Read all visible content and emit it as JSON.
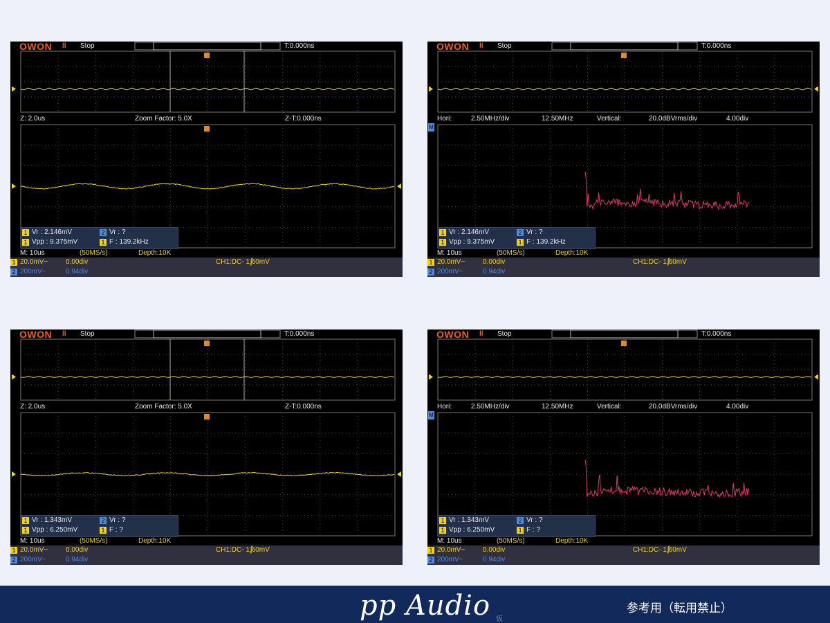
{
  "colors": {
    "trace": "#f3d21a",
    "fft": "#e0386c",
    "grid": "#444",
    "bg": "#000",
    "brand": "#f25c1e"
  },
  "scopes": [
    {
      "mode": "zoom",
      "logo": "OWON",
      "run_icon": "pause-icon",
      "state": "Stop",
      "trigger_time": "T:0.000ns",
      "mid_left": "Z: 2.0us",
      "mid_center": "Zoom Factor: 5.0X",
      "mid_right": "Z-T:0.000ns",
      "meas": {
        "vr1": "Vr : 2.146mV",
        "vr2": "Vr :     ?",
        "vpp": "Vpp : 9.375mV",
        "f": "F : 139.2kHz"
      },
      "timebase": "M: 10us",
      "rate": "(50MS/s)",
      "depth": "Depth:10K",
      "ch1_scale": "20.0mV~",
      "ch1_offset": "0.00div",
      "trig": "CH1:DC-   1.60mV",
      "ch2_scale": "200mV~",
      "ch2_offset": "0.94div",
      "amplitude": 1.0
    },
    {
      "mode": "fft",
      "logo": "OWON",
      "run_icon": "pause-icon",
      "state": "Stop",
      "trigger_time": "T:0.000ns",
      "hori_label": "Hori:",
      "hori_val": "2.50MHz/div",
      "center_freq": "12.50MHz",
      "vert_label": "Vertical:",
      "vert_val": "20.0dBVrms/div",
      "vert_div": "4.00div",
      "meas": {
        "vr1": "Vr : 2.146mV",
        "vr2": "Vr :     ?",
        "vpp": "Vpp : 9.375mV",
        "f": "F : 139.2kHz"
      },
      "timebase": "M: 10us",
      "rate": "(50MS/s)",
      "depth": "Depth:10K",
      "ch1_scale": "20.0mV~",
      "ch1_offset": "0.00div",
      "trig": "CH1:DC-   1.60mV",
      "ch2_scale": "200mV~",
      "ch2_offset": "0.94div",
      "amplitude": 1.0
    },
    {
      "mode": "zoom",
      "logo": "OWON",
      "run_icon": "pause-icon",
      "state": "Stop",
      "trigger_time": "T:0.000ns",
      "mid_left": "Z: 2.0us",
      "mid_center": "Zoom Factor: 5.0X",
      "mid_right": "Z-T:0.000ns",
      "meas": {
        "vr1": "Vr : 1.343mV",
        "vr2": "Vr :     ?",
        "vpp": "Vpp : 6.250mV",
        "f": "F :     ?"
      },
      "timebase": "M: 10us",
      "rate": "(50MS/s)",
      "depth": "Depth:10K",
      "ch1_scale": "20.0mV~",
      "ch1_offset": "0.00div",
      "trig": "CH1:DC-   1.60mV",
      "ch2_scale": "200mV~",
      "ch2_offset": "0.94div",
      "amplitude": 0.6
    },
    {
      "mode": "fft",
      "logo": "OWON",
      "run_icon": "pause-icon",
      "state": "Stop",
      "trigger_time": "T:0.000ns",
      "hori_label": "Hori:",
      "hori_val": "2.50MHz/div",
      "center_freq": "12.50MHz",
      "vert_label": "Vertical:",
      "vert_val": "20.0dBVrms/div",
      "vert_div": "4.00div",
      "meas": {
        "vr1": "Vr : 1.343mV",
        "vr2": "Vr :     ?",
        "vpp": "Vpp : 6.250mV",
        "f": "F :     ?"
      },
      "timebase": "M: 10us",
      "rate": "(50MS/s)",
      "depth": "Depth:10K",
      "ch1_scale": "20.0mV~",
      "ch1_offset": "0.00div",
      "trig": "CH1:DC-   1.60mV",
      "ch2_scale": "200mV~",
      "ch2_offset": "0.94div",
      "amplitude": 0.6
    }
  ],
  "footer": {
    "brand": "pp Audio",
    "brand_sub": "仮",
    "note": "参考用（転用禁止）"
  }
}
